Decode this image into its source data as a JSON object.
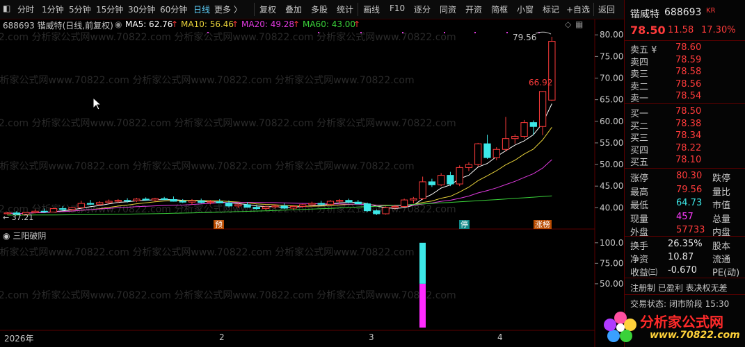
{
  "toolbar": {
    "items": [
      "分时",
      "1分钟",
      "5分钟",
      "15分钟",
      "30分钟",
      "60分钟",
      "日线",
      "更多 〉",
      "复权",
      "叠加",
      "多股",
      "统计",
      "画线",
      "F10",
      "逐分",
      "同资",
      "开资",
      "简框",
      "小窗",
      "标记",
      "+自选",
      "返回"
    ],
    "active": "日线"
  },
  "header": {
    "stock": "688693 锴威特(日线,前复权)",
    "ma5": "MA5: 62.76",
    "ma10": "MA10: 56.46",
    "ma20": "MA20: 49.28",
    "ma60": "MA60: 43.00",
    "arrow": "↑"
  },
  "annotations": {
    "high_label": "79.56",
    "mid_label": "66.92",
    "low_label": "37.21",
    "badge_yu": "预",
    "badge_ting": "停",
    "badge_zhangbang": "涨榜"
  },
  "indicator": {
    "name": "三阳破阴",
    "bar_value": 100.0
  },
  "xaxis": {
    "labels": [
      "2026年",
      "2",
      "3",
      "4"
    ]
  },
  "watermark": "822.com 分析家公式网www.70822.com 分析家公式网www.70822.com 分析家公式网www.70822.com",
  "chart_data": {
    "type": "candlestick",
    "price_axis": {
      "ticks": [
        40.0,
        45.0,
        50.0,
        55.0,
        60.0,
        65.0,
        70.0,
        75.0,
        80.0
      ],
      "range": [
        37.0,
        81.0
      ]
    },
    "indicator_axis": {
      "ticks": [
        50.0,
        75.0,
        100.0
      ],
      "range": [
        0,
        110
      ]
    },
    "candles": [
      [
        38.6,
        39.0,
        38.4,
        38.8
      ],
      [
        38.8,
        39.2,
        38.3,
        38.5
      ],
      [
        38.5,
        39.0,
        38.2,
        38.9
      ],
      [
        38.9,
        39.6,
        38.7,
        39.2
      ],
      [
        39.2,
        39.8,
        38.8,
        39.0
      ],
      [
        39.0,
        40.0,
        38.9,
        39.8
      ],
      [
        39.8,
        40.4,
        39.3,
        39.6
      ],
      [
        39.6,
        40.2,
        39.2,
        40.0
      ],
      [
        40.0,
        41.6,
        39.8,
        41.0
      ],
      [
        41.0,
        41.8,
        40.6,
        40.8
      ],
      [
        40.8,
        41.5,
        40.5,
        41.2
      ],
      [
        41.2,
        41.9,
        40.9,
        41.5
      ],
      [
        41.5,
        42.0,
        41.1,
        41.7
      ],
      [
        41.7,
        42.2,
        41.2,
        41.6
      ],
      [
        41.6,
        42.3,
        41.3,
        42.0
      ],
      [
        42.0,
        42.4,
        41.6,
        41.8
      ],
      [
        41.8,
        42.3,
        41.5,
        42.1
      ],
      [
        42.1,
        42.5,
        41.8,
        41.9
      ],
      [
        41.9,
        42.6,
        41.4,
        41.5
      ],
      [
        41.5,
        42.0,
        41.1,
        41.3
      ],
      [
        41.3,
        42.0,
        40.7,
        41.6
      ],
      [
        41.6,
        42.1,
        41.0,
        41.2
      ],
      [
        41.2,
        41.8,
        40.8,
        41.4
      ],
      [
        41.4,
        42.0,
        41.0,
        41.1
      ],
      [
        41.1,
        41.7,
        40.1,
        40.4
      ],
      [
        40.4,
        41.0,
        39.9,
        40.7
      ],
      [
        40.7,
        41.3,
        40.3,
        40.1
      ],
      [
        40.1,
        40.7,
        39.5,
        39.8
      ],
      [
        39.8,
        40.5,
        39.4,
        40.2
      ],
      [
        40.2,
        40.8,
        39.8,
        40.4
      ],
      [
        40.4,
        41.0,
        39.7,
        39.9
      ],
      [
        39.9,
        40.6,
        39.5,
        40.3
      ],
      [
        40.3,
        40.9,
        40.0,
        40.7
      ],
      [
        40.7,
        41.4,
        40.3,
        41.0
      ],
      [
        41.0,
        41.6,
        40.6,
        40.8
      ],
      [
        40.8,
        41.8,
        40.5,
        41.5
      ],
      [
        41.5,
        42.0,
        41.0,
        41.7
      ],
      [
        41.7,
        42.1,
        41.0,
        41.3
      ],
      [
        41.3,
        41.8,
        40.9,
        40.9
      ],
      [
        40.9,
        41.2,
        39.0,
        39.3
      ],
      [
        39.3,
        39.6,
        38.3,
        38.6
      ],
      [
        38.6,
        40.3,
        38.4,
        40.0
      ],
      [
        40.0,
        40.7,
        39.6,
        40.3
      ],
      [
        40.3,
        42.1,
        40.1,
        41.8
      ],
      [
        41.8,
        42.5,
        41.0,
        42.1
      ],
      [
        42.1,
        47.2,
        41.8,
        46.0
      ],
      [
        46.0,
        46.7,
        44.8,
        45.3
      ],
      [
        45.3,
        48.0,
        45.0,
        47.5
      ],
      [
        47.5,
        48.3,
        45.0,
        45.5
      ],
      [
        45.5,
        49.8,
        45.0,
        49.3
      ],
      [
        49.3,
        50.5,
        48.5,
        50.0
      ],
      [
        50.0,
        55.0,
        49.5,
        54.8
      ],
      [
        54.8,
        56.9,
        51.3,
        51.6
      ],
      [
        51.6,
        54.0,
        51.0,
        53.5
      ],
      [
        53.5,
        61.0,
        53.0,
        56.0
      ],
      [
        56.0,
        57.0,
        54.8,
        56.5
      ],
      [
        56.5,
        60.3,
        56.0,
        59.7
      ],
      [
        59.7,
        60.2,
        56.8,
        58.8
      ],
      [
        58.8,
        67.0,
        56.8,
        66.9
      ],
      [
        64.9,
        79.56,
        64.73,
        78.5
      ]
    ],
    "series": [
      {
        "name": "MA5",
        "color": "#ffffff"
      },
      {
        "name": "MA10",
        "color": "#e8d23a"
      },
      {
        "name": "MA20",
        "color": "#e03ae0"
      },
      {
        "name": "MA60",
        "color": "#3ad23a"
      }
    ]
  },
  "panel": {
    "name": "锴威特",
    "code": "688693",
    "tag": "KR",
    "price": "78.50",
    "change": "11.58",
    "pct": "17.30%",
    "asks": [
      {
        "label": "卖五 ¥",
        "price": "78.60"
      },
      {
        "label": "卖四",
        "price": "78.59"
      },
      {
        "label": "卖三",
        "price": "78.58"
      },
      {
        "label": "卖二",
        "price": "78.56"
      },
      {
        "label": "卖一",
        "price": "78.54"
      }
    ],
    "bids": [
      {
        "label": "买一",
        "price": "78.50"
      },
      {
        "label": "买二",
        "price": "78.38"
      },
      {
        "label": "买三",
        "price": "78.34"
      },
      {
        "label": "买四",
        "price": "78.22"
      },
      {
        "label": "买五",
        "price": "78.10"
      }
    ],
    "stats": [
      {
        "l1": "涨停",
        "v1": "80.30",
        "c": "red",
        "l2": "跌停"
      },
      {
        "l1": "最高",
        "v1": "79.56",
        "c": "red",
        "l2": "量比"
      },
      {
        "l1": "最低",
        "v1": "64.73",
        "c": "cyan",
        "l2": "市值"
      },
      {
        "l1": "现量",
        "v1": "457",
        "c": "mag",
        "l2": "总量"
      },
      {
        "l1": "外盘",
        "v1": "57733",
        "c": "red",
        "l2": "内盘"
      }
    ],
    "stats2": [
      {
        "l1": "换手",
        "v1": "26.35%",
        "l2": "股本"
      },
      {
        "l1": "净资",
        "v1": "10.87",
        "l2": "流通"
      },
      {
        "l1": "收益㈢",
        "v1": "-0.670",
        "l2": "PE(动)"
      }
    ],
    "reg": "注册制 已盈利 表决权无差",
    "trade": "交易状态: 闭市阶段 15:30"
  },
  "logo": {
    "text": "分析家公式网",
    "url": "www.70822.com"
  }
}
